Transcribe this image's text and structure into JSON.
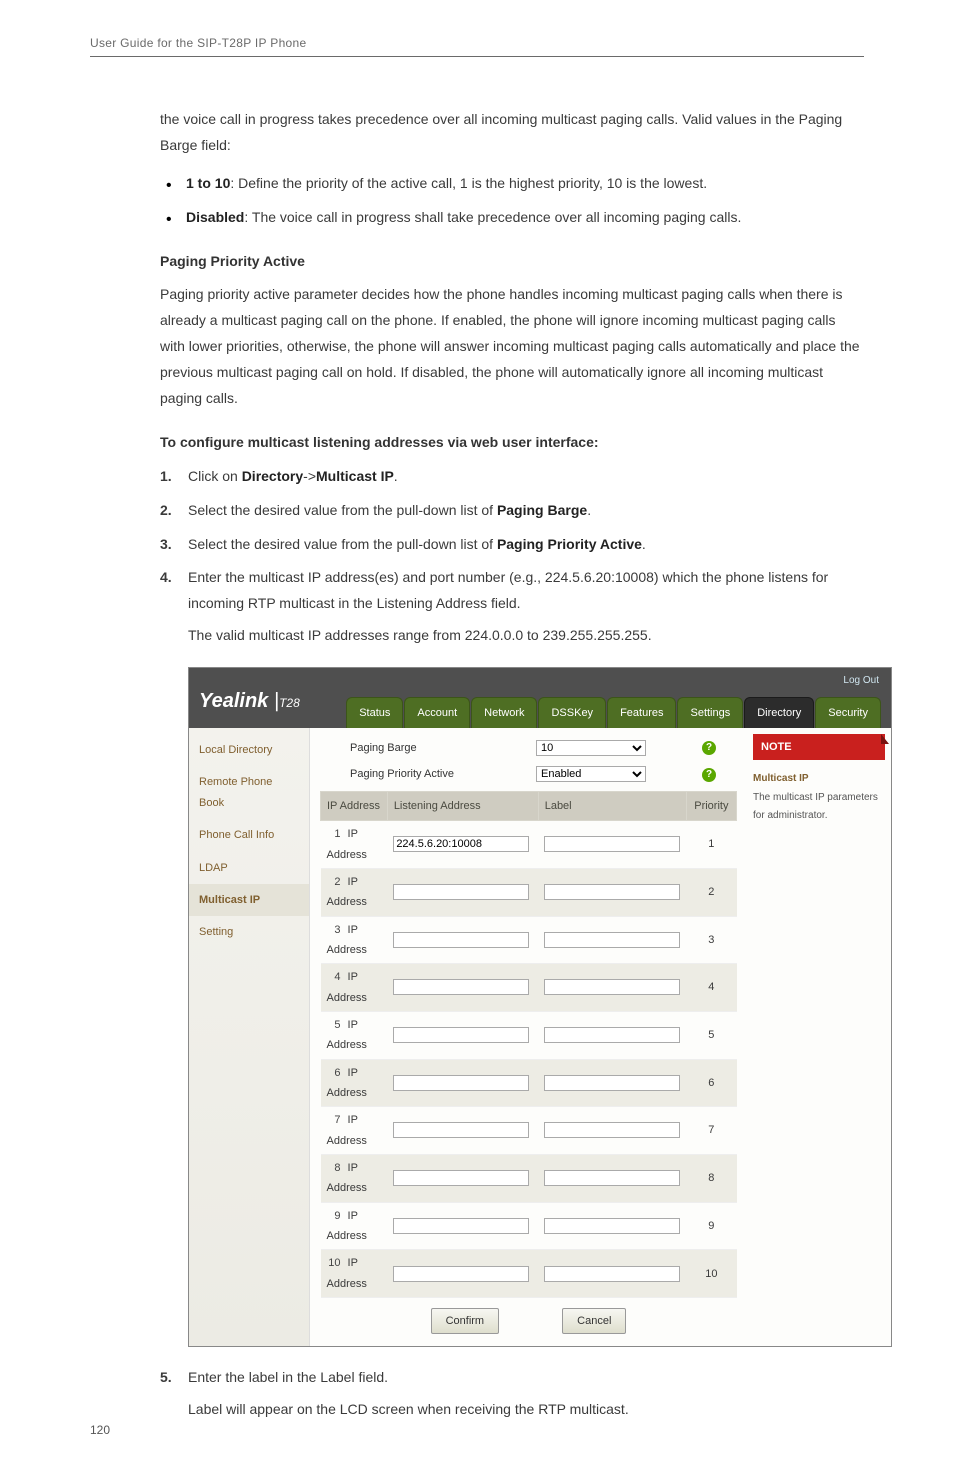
{
  "header": "User Guide for the SIP-T28P IP Phone",
  "intro_para": "the voice call in progress takes precedence over all incoming multicast paging calls. Valid values in the Paging Barge field:",
  "bullets": [
    {
      "b": "1 to 10",
      "text": ": Define the priority of the active call, 1 is the highest priority, 10 is the lowest."
    },
    {
      "b": "Disabled",
      "text": ": The voice call in progress shall take precedence over all incoming paging calls."
    }
  ],
  "heading1": "Paging Priority Active",
  "ppa_para": "Paging priority active parameter decides how the phone handles incoming multicast paging calls when there is already a multicast paging call on the phone. If enabled, the phone will ignore incoming multicast paging calls with lower priorities, otherwise, the phone will answer incoming multicast paging calls automatically and place the previous multicast paging call on hold. If disabled, the phone will automatically ignore all incoming multicast paging calls.",
  "heading2": "To configure multicast listening addresses via web user interface:",
  "steps": [
    {
      "pre": "Click on ",
      "b1": "Directory",
      "mid": "->",
      "b2": "Multicast IP",
      "post": "."
    },
    {
      "pre": "Select the desired value from the pull-down list of ",
      "b1": "Paging Barge",
      "mid": "",
      "b2": "",
      "post": "."
    },
    {
      "pre": "Select the desired value from the pull-down list of ",
      "b1": "Paging Priority Active",
      "mid": "",
      "b2": "",
      "post": "."
    },
    {
      "pre": "Enter the multicast IP address(es) and port number (e.g., 224.5.6.20:10008) which the phone listens for incoming RTP multicast in the Listening Address field.",
      "b1": "",
      "mid": "",
      "b2": "",
      "post": ""
    }
  ],
  "step4_extra": "The valid multicast IP addresses range from 224.0.0.0 to 239.255.255.255.",
  "step5": {
    "pre": "Enter the label in the Label field.",
    "sub": "Label will appear on the LCD screen when receiving the RTP multicast."
  },
  "ui": {
    "logo": "Yealink",
    "model": "T28",
    "logout": "Log Out",
    "tabs": [
      "Status",
      "Account",
      "Network",
      "DSSKey",
      "Features",
      "Settings",
      "Directory",
      "Security"
    ],
    "active_tab": "Directory",
    "sidebar": [
      "Local Directory",
      "Remote Phone Book",
      "Phone Call Info",
      "LDAP",
      "Multicast IP",
      "Setting"
    ],
    "sidebar_active": "Multicast IP",
    "form": {
      "paging_barge_label": "Paging Barge",
      "paging_barge_value": "10",
      "ppa_label": "Paging Priority Active",
      "ppa_value": "Enabled"
    },
    "table": {
      "headers": [
        "IP Address",
        "Listening Address",
        "Label",
        "Priority"
      ],
      "rows": [
        {
          "n": 1,
          "ip": "IP Address",
          "addr": "224.5.6.20:10008",
          "label": "",
          "pri": "1"
        },
        {
          "n": 2,
          "ip": "IP Address",
          "addr": "",
          "label": "",
          "pri": "2"
        },
        {
          "n": 3,
          "ip": "IP Address",
          "addr": "",
          "label": "",
          "pri": "3"
        },
        {
          "n": 4,
          "ip": "IP Address",
          "addr": "",
          "label": "",
          "pri": "4"
        },
        {
          "n": 5,
          "ip": "IP Address",
          "addr": "",
          "label": "",
          "pri": "5"
        },
        {
          "n": 6,
          "ip": "IP Address",
          "addr": "",
          "label": "",
          "pri": "6"
        },
        {
          "n": 7,
          "ip": "IP Address",
          "addr": "",
          "label": "",
          "pri": "7"
        },
        {
          "n": 8,
          "ip": "IP Address",
          "addr": "",
          "label": "",
          "pri": "8"
        },
        {
          "n": 9,
          "ip": "IP Address",
          "addr": "",
          "label": "",
          "pri": "9"
        },
        {
          "n": 10,
          "ip": "IP Address",
          "addr": "",
          "label": "",
          "pri": "10"
        }
      ]
    },
    "buttons": {
      "confirm": "Confirm",
      "cancel": "Cancel"
    },
    "note": {
      "title": "NOTE",
      "subtitle": "Multicast IP",
      "text": "The multicast IP parameters for administrator."
    }
  },
  "page_number": "120"
}
